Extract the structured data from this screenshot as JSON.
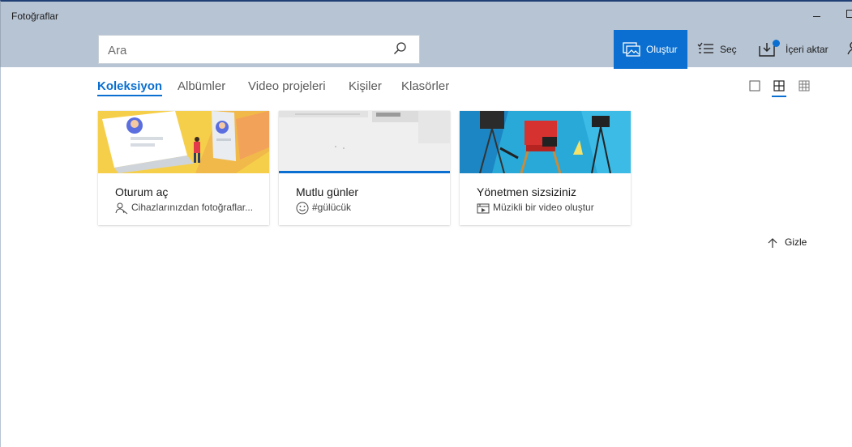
{
  "app": {
    "title": "Fotoğraflar"
  },
  "search": {
    "placeholder": "Ara"
  },
  "toolbar": {
    "create_label": "Oluştur",
    "select_label": "Seç",
    "import_label": "İçeri aktar"
  },
  "tabs": [
    {
      "label": "Koleksiyon",
      "active": true
    },
    {
      "label": "Albümler",
      "active": false
    },
    {
      "label": "Video projeleri",
      "active": false
    },
    {
      "label": "Kişiler",
      "active": false
    },
    {
      "label": "Klasörler",
      "active": false
    }
  ],
  "view_modes": [
    "single-square-icon",
    "medium-grid-icon",
    "small-grid-icon"
  ],
  "cards": [
    {
      "title": "Oturum aç",
      "subtitle": "Cihazlarınızdan fotoğraflar...",
      "icon": "people-icon"
    },
    {
      "title": "Mutlu günler",
      "subtitle": "#gülücük",
      "icon": "smiley-icon"
    },
    {
      "title": "Yönetmen sizsiziniz",
      "subtitle": "Müzikli bir video oluştur",
      "icon": "video-editor-icon"
    }
  ],
  "hide": {
    "label": "Gizle"
  },
  "colors": {
    "accent": "#0a6fd0",
    "titlebar": "#b7c4d3"
  }
}
